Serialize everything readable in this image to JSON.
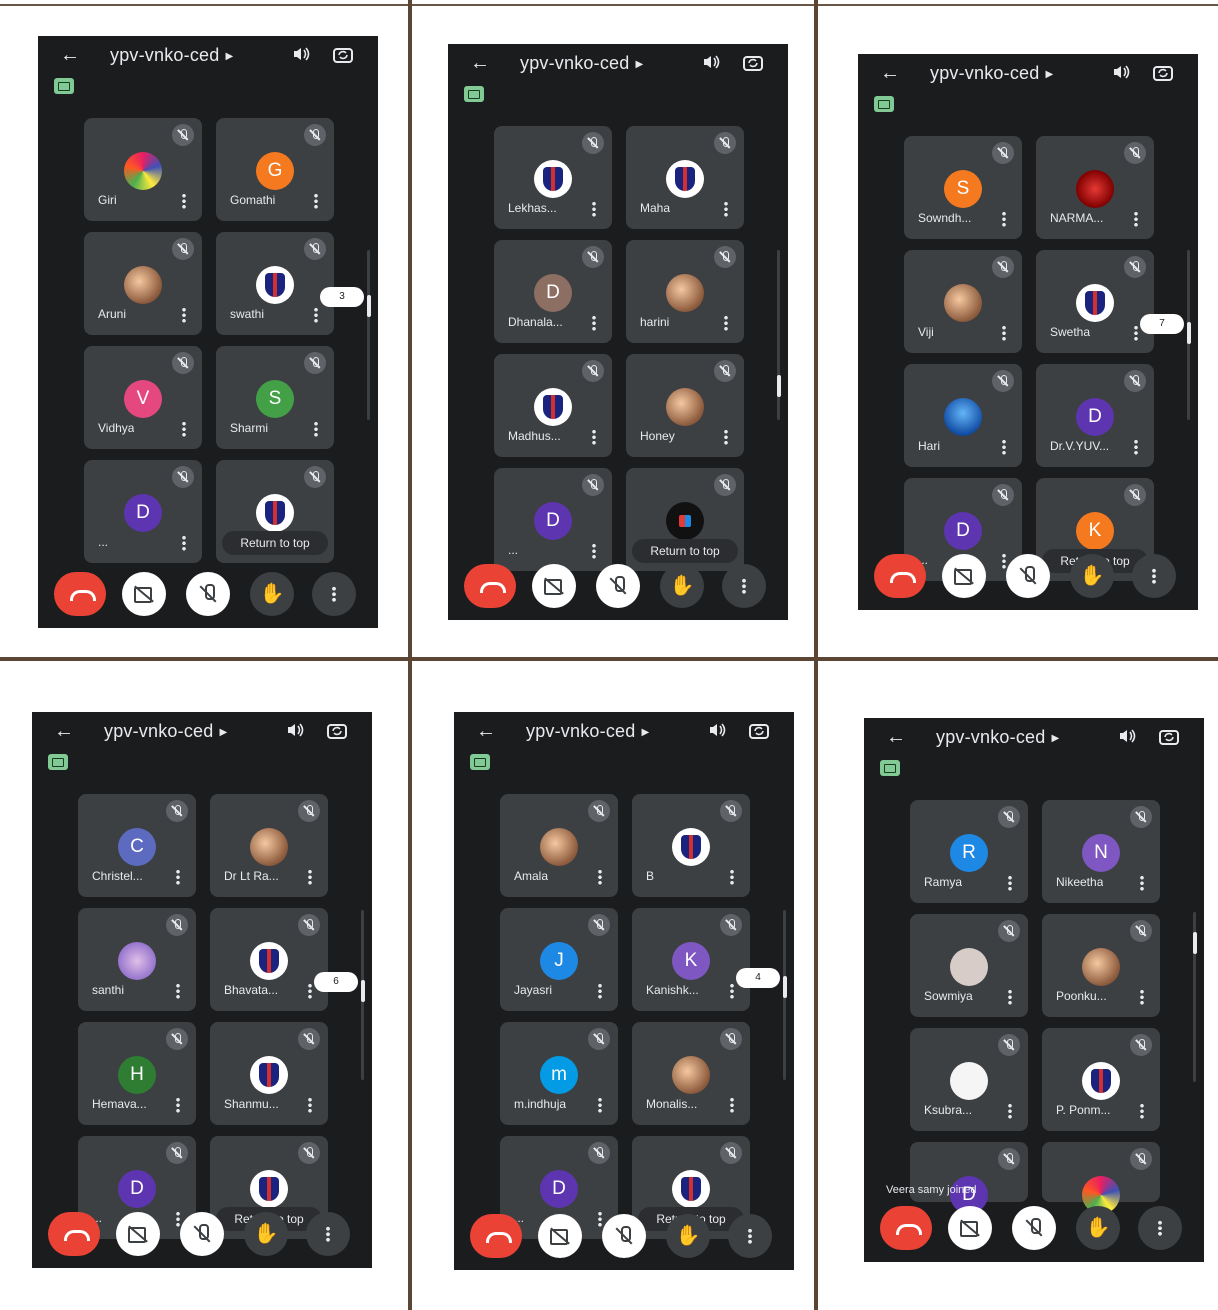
{
  "meeting_code": "ypv-vnko-ced",
  "screens": [
    {
      "page_indicator": "3",
      "tiles": [
        {
          "name": "Giri",
          "initial": "",
          "avatar": "multi"
        },
        {
          "name": "Gomathi",
          "initial": "G",
          "color": "#f4791f"
        },
        {
          "name": "Aruni",
          "initial": "",
          "avatar": "photo"
        },
        {
          "name": "swathi",
          "initial": "",
          "avatar": "logo"
        },
        {
          "name": "Vidhya",
          "initial": "V",
          "color": "#e5487e"
        },
        {
          "name": "Sharmi",
          "initial": "S",
          "color": "#43a047"
        },
        {
          "name": "...",
          "initial": "D",
          "color": "#5e35b1"
        },
        {
          "name": "",
          "initial": "",
          "avatar": "logo",
          "return_to_top": "Return to top"
        }
      ]
    },
    {
      "page_indicator": "",
      "tiles": [
        {
          "name": "Lekhas...",
          "initial": "",
          "avatar": "logo"
        },
        {
          "name": "Maha",
          "initial": "",
          "avatar": "logo"
        },
        {
          "name": "Dhanala...",
          "initial": "D",
          "color": "#8d6e63"
        },
        {
          "name": "harini",
          "initial": "",
          "avatar": "photo"
        },
        {
          "name": "Madhus...",
          "initial": "",
          "avatar": "logo"
        },
        {
          "name": "Honey",
          "initial": "",
          "avatar": "photo"
        },
        {
          "name": "...",
          "initial": "D",
          "color": "#5e35b1"
        },
        {
          "name": "",
          "initial": "",
          "avatar": "black",
          "return_to_top": "Return to top"
        }
      ]
    },
    {
      "page_indicator": "7",
      "tiles": [
        {
          "name": "Sowndh...",
          "initial": "S",
          "color": "#f4791f"
        },
        {
          "name": "NARMA...",
          "initial": "",
          "avatar": "rose"
        },
        {
          "name": "Viji",
          "initial": "",
          "avatar": "photo"
        },
        {
          "name": "Swetha",
          "initial": "",
          "avatar": "logo"
        },
        {
          "name": "Hari",
          "initial": "",
          "avatar": "sky"
        },
        {
          "name": "Dr.V.YUV...",
          "initial": "D",
          "color": "#5e35b1"
        },
        {
          "name": "...",
          "initial": "D",
          "color": "#5e35b1"
        },
        {
          "name": "",
          "initial": "K",
          "color": "#f4791f",
          "return_to_top": "Return to top"
        }
      ]
    },
    {
      "page_indicator": "6",
      "tiles": [
        {
          "name": "Christel...",
          "initial": "C",
          "color": "#5c6bc0"
        },
        {
          "name": "Dr Lt Ra...",
          "initial": "",
          "avatar": "photo"
        },
        {
          "name": "santhi",
          "initial": "",
          "avatar": "flower"
        },
        {
          "name": "Bhavata...",
          "initial": "",
          "avatar": "logo"
        },
        {
          "name": "Hemava...",
          "initial": "H",
          "color": "#2e7d32"
        },
        {
          "name": "Shanmu...",
          "initial": "",
          "avatar": "logo"
        },
        {
          "name": "...",
          "initial": "D",
          "color": "#5e35b1"
        },
        {
          "name": "",
          "initial": "",
          "avatar": "logo",
          "return_to_top": "Return to top"
        }
      ]
    },
    {
      "page_indicator": "4",
      "tiles": [
        {
          "name": "Amala",
          "initial": "",
          "avatar": "photo"
        },
        {
          "name": "B",
          "initial": "",
          "avatar": "logo"
        },
        {
          "name": "Jayasri",
          "initial": "J",
          "color": "#1e88e5"
        },
        {
          "name": "Kanishk...",
          "initial": "K",
          "color": "#7e57c2"
        },
        {
          "name": "m.indhuja",
          "initial": "m",
          "color": "#039be5"
        },
        {
          "name": "Monalis...",
          "initial": "",
          "avatar": "photo"
        },
        {
          "name": "...",
          "initial": "D",
          "color": "#5e35b1"
        },
        {
          "name": "",
          "initial": "",
          "avatar": "logo",
          "return_to_top": "Return to top"
        }
      ]
    },
    {
      "page_indicator": "",
      "toast": "Veera samy joined",
      "tiles": [
        {
          "name": "Ramya",
          "initial": "R",
          "color": "#1e88e5"
        },
        {
          "name": "Nikeetha",
          "initial": "N",
          "color": "#7e57c2"
        },
        {
          "name": "Sowmiya",
          "initial": "",
          "avatar": "snake"
        },
        {
          "name": "Poonku...",
          "initial": "",
          "avatar": "photo"
        },
        {
          "name": "Ksubra...",
          "initial": "",
          "avatar": "paper"
        },
        {
          "name": "P. Ponm...",
          "initial": "",
          "avatar": "logo"
        },
        {
          "name": "",
          "initial": "D",
          "color": "#5e35b1",
          "partial": true
        },
        {
          "name": "",
          "initial": "",
          "avatar": "multi",
          "partial": true
        }
      ]
    }
  ],
  "icons": {
    "back": "arrow-left-icon",
    "speaker": "speaker-icon",
    "switch_camera": "switch-camera-icon",
    "cast": "cast-icon",
    "mic_off": "mic-off-icon",
    "end_call": "end-call-icon",
    "camera_off": "camera-off-icon",
    "mute": "mic-off-icon",
    "raise_hand": "hand-icon",
    "more": "more-vert-icon"
  },
  "colors": {
    "end_call": "#ea4335",
    "background": "#1a1c1e",
    "tile": "#3c4043",
    "cast_badge": "#81c995"
  }
}
